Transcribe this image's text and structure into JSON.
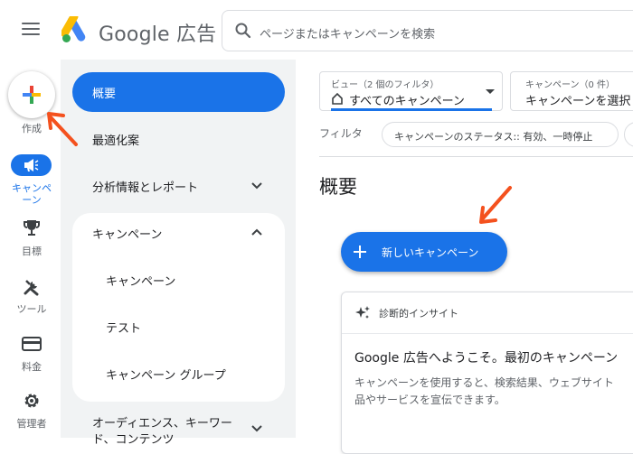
{
  "header": {
    "brand_name": "Google 広告",
    "search_placeholder": "ページまたはキャンペーンを検索"
  },
  "rail": {
    "create_label": "作成",
    "items": [
      {
        "label_line1": "キャンペ",
        "label_line2": "ーン",
        "icon": "megaphone-icon",
        "active": true
      },
      {
        "label": "目標",
        "icon": "trophy-icon"
      },
      {
        "label": "ツール",
        "icon": "tools-icon"
      },
      {
        "label": "料金",
        "icon": "credit-card-icon"
      },
      {
        "label": "管理者",
        "icon": "gear-icon"
      }
    ]
  },
  "sidenav": {
    "items": [
      {
        "label": "概要",
        "active": true
      },
      {
        "label": "最適化案"
      },
      {
        "label": "分析情報とレポート"
      },
      {
        "label": "キャンペーン"
      },
      {
        "label": "キャンペーン"
      },
      {
        "label": "テスト"
      },
      {
        "label": "キャンペーン グループ"
      },
      {
        "label_line1": "オーディエンス、キーワー",
        "label_line2": "ド、コンテンツ"
      }
    ]
  },
  "filters": {
    "view_label": "ビュー（2 個のフィルタ）",
    "view_value": "すべてのキャンペーン",
    "campaign_label": "キャンペーン（0 件）",
    "campaign_value": "キャンペーンを選択",
    "filter_label": "フィルタ",
    "chip_text": "キャンペーンのステータス:: 有効、一時停止"
  },
  "main": {
    "title": "概要",
    "new_campaign_label": "新しいキャンペーン",
    "insight": {
      "header": "診断的インサイト",
      "title": "Google 広告へようこそ。最初のキャンペーン",
      "body_line1": "キャンペーンを使用すると、検索結果、ウェブサイト",
      "body_line2": "品やサービスを宣伝できます。"
    }
  },
  "colors": {
    "accent": "#1a73e8",
    "annotation_arrow": "#f4511e"
  }
}
